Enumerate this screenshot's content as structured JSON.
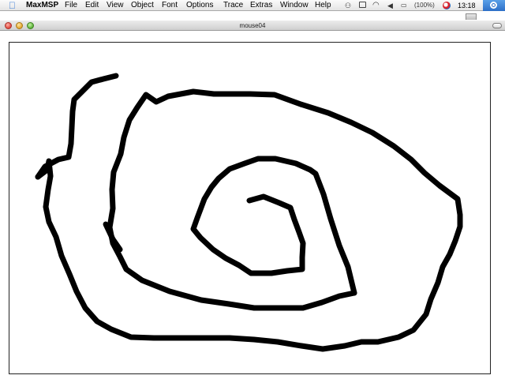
{
  "menubar": {
    "apple_icon": "apple-logo-icon",
    "app_name": "MaxMSP",
    "items": [
      "File",
      "Edit",
      "View",
      "Object",
      "Font",
      "Options",
      "Trace",
      "Extras",
      "Window",
      "Help"
    ],
    "status": {
      "battery": "(100%)",
      "clock": "13:18",
      "extras_icons": [
        "script-menu-icon",
        "display-icon",
        "wifi-icon",
        "volume-icon",
        "battery-icon",
        "input-flag-icon"
      ],
      "spotlight_icon": "spotlight-icon"
    }
  },
  "window": {
    "title": "mouse04",
    "buttons": [
      "close-button",
      "minimize-button",
      "zoom-button"
    ]
  },
  "colors": {
    "stroke": "#000000",
    "canvas_bg": "#ffffff"
  }
}
